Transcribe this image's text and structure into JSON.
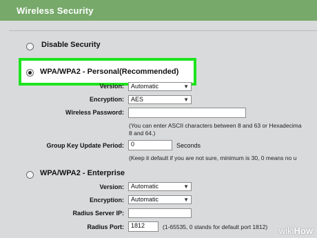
{
  "header": {
    "title": "Wireless Security"
  },
  "options": {
    "disable": {
      "label": "Disable Security"
    },
    "personal": {
      "label": "WPA/WPA2 - Personal(Recommended)"
    },
    "enterprise": {
      "label": "WPA/WPA2 - Enterprise"
    }
  },
  "personal": {
    "version_label": "Version:",
    "version_value": "Automatic",
    "encryption_label": "Encryption:",
    "encryption_value": "AES",
    "password_label": "Wireless Password:",
    "password_value": "",
    "password_note_1": "(You can enter ASCII characters between 8 and 63 or Hexadecima",
    "password_note_2": "8 and 64.)",
    "gku_label": "Group Key Update Period:",
    "gku_value": "0",
    "gku_unit": "Seconds",
    "gku_note": "(Keep it default if you are not sure, minimum is 30, 0 means no u"
  },
  "enterprise": {
    "version_label": "Version:",
    "version_value": "Automatic",
    "encryption_label": "Encryption:",
    "encryption_value": "Automatic",
    "radius_ip_label": "Radius Server IP:",
    "radius_ip_value": "",
    "radius_port_label": "Radius Port:",
    "radius_port_value": "1812",
    "radius_port_note": "(1-65535, 0 stands for default port 1812)"
  },
  "watermark": {
    "prefix": "wiki",
    "suffix": "How"
  },
  "colors": {
    "header_bg": "#76a96a",
    "highlight_border": "#1ee31e",
    "page_bg": "#d9dadb"
  }
}
